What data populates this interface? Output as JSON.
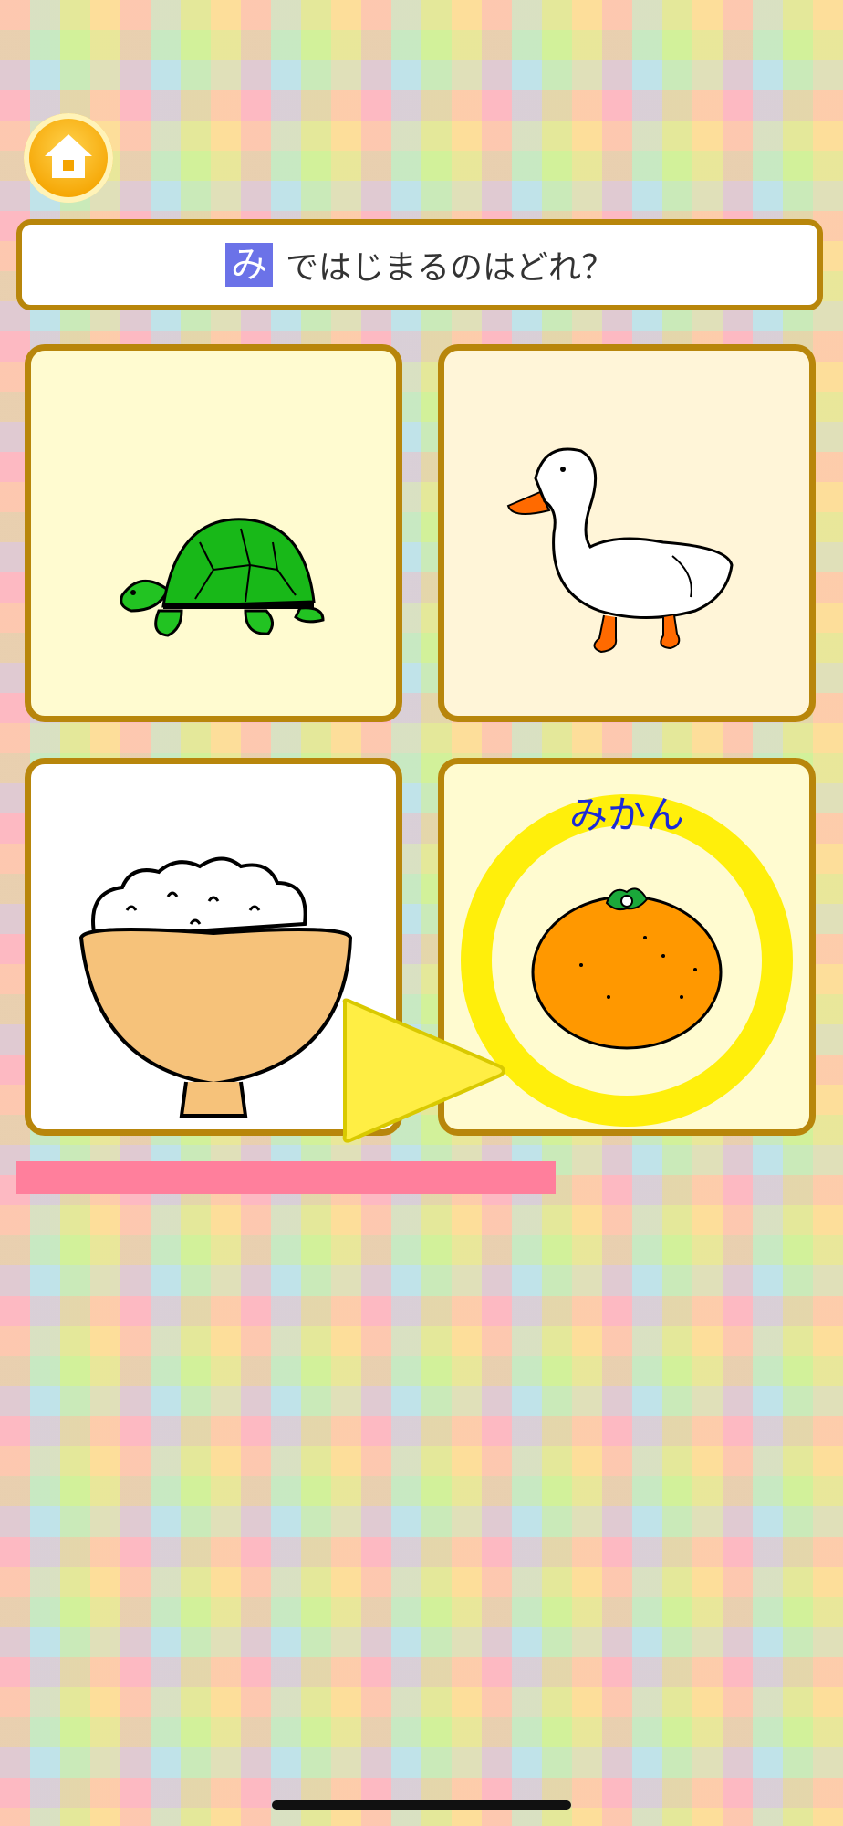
{
  "home_button": {
    "icon": "home-icon"
  },
  "question": {
    "target_char": "み",
    "text": "ではじまるのはどれ？"
  },
  "choices": [
    {
      "icon": "turtle-icon"
    },
    {
      "icon": "duck-icon"
    },
    {
      "icon": "rice-bowl-icon"
    },
    {
      "icon": "mandarin-orange-icon",
      "label": "みかん",
      "highlighted": true
    }
  ],
  "next_arrow": {
    "icon": "play-arrow-icon"
  },
  "progress": {
    "fraction": 0.66,
    "color": "#ff7f9c"
  },
  "colors": {
    "card_border": "#b8860b",
    "answer_label": "#1a2ad8",
    "highlight_ring": "#ffee00"
  }
}
